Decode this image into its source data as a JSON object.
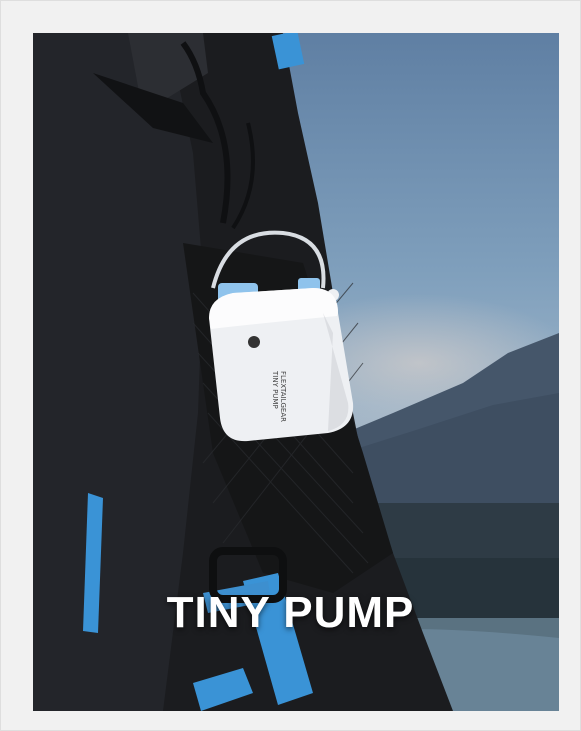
{
  "headline": "TINY PUMP",
  "device": {
    "brand": "FLEXTAILGEAR",
    "model": "TINY PUMP"
  },
  "colors": {
    "accent_blue": "#3a93d6",
    "pack_black": "#1b1c1f",
    "pump_white": "#eef0f3"
  }
}
